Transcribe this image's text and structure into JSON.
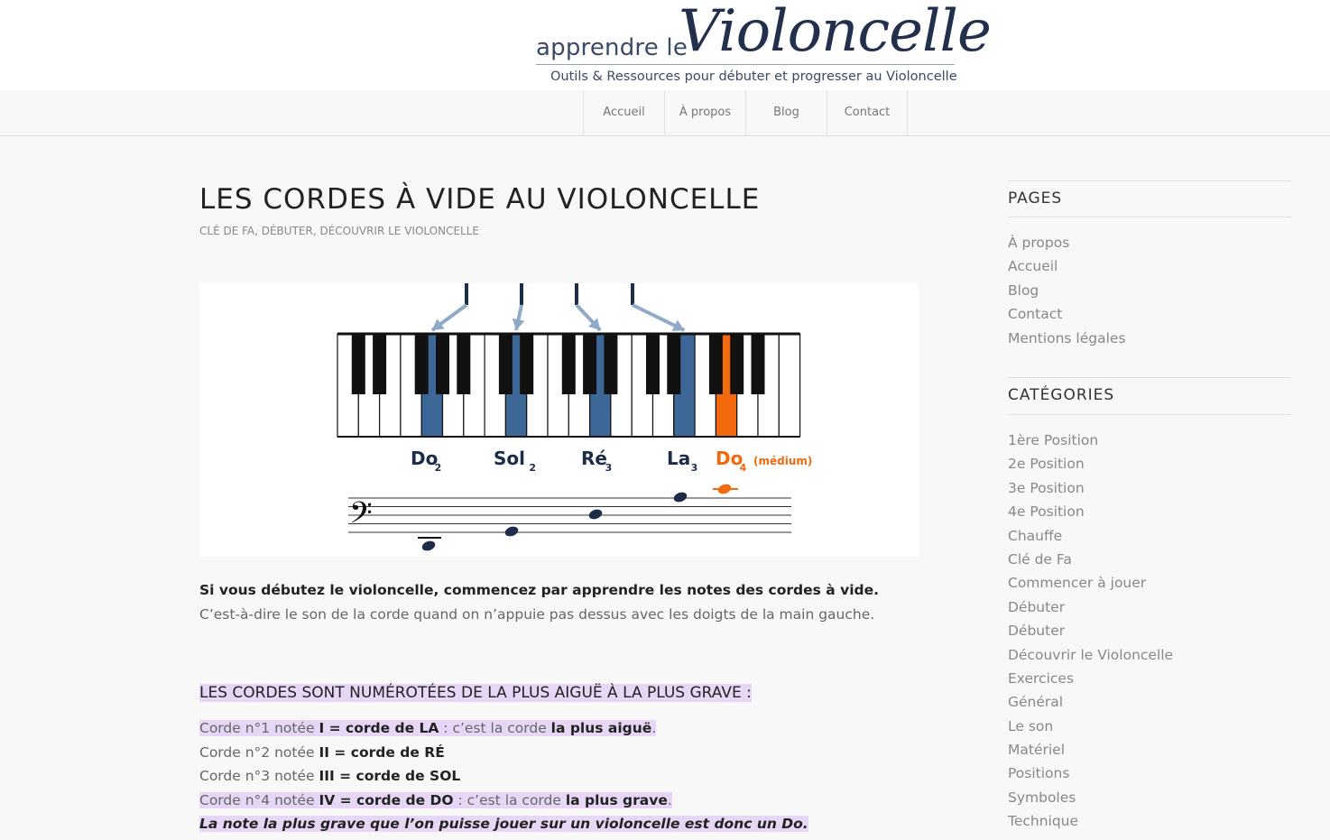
{
  "logo": {
    "small": "apprendre le",
    "big": "Violoncelle",
    "tagline": "Outils & Ressources pour débuter et progresser au Violoncelle"
  },
  "nav": [
    "Accueil",
    "À propos",
    "Blog",
    "Contact"
  ],
  "post": {
    "title": "LES CORDES À VIDE AU VIOLONCELLE",
    "categories": "CLÉ DE FA, DÉBUTER, DÉCOUVRIR LE VIOLONCELLE",
    "figure": {
      "notes": [
        "Do",
        "Sol",
        "Ré",
        "La",
        "Do"
      ],
      "subs": [
        "2",
        "2",
        "3",
        "3",
        "4"
      ],
      "medium": "(médium)",
      "colors": {
        "highlight": "#3d6797",
        "orange": "#f26a0d",
        "arrow": "#8fa9c8",
        "dark": "#1d2c48"
      }
    },
    "intro_bold": "Si vous débutez le violoncelle, commencez par apprendre les notes des cordes à vide.",
    "intro_rest": " C’est-à-dire le son de la corde quand on n’appuie pas dessus avec les doigts de la main gauche.",
    "subhead": "LES CORDES SONT NUMÉROTÉES DE LA PLUS AIGUË À LA PLUS GRAVE :",
    "c1a": "Corde n°1 notée ",
    "c1b": "I = corde de LA",
    "c1c": " : c’est la corde ",
    "c1d": "la plus aiguë",
    "c1e": ".",
    "c2a": "Corde n°2 notée ",
    "c2b": "II = corde de RÉ",
    "c3a": "Corde n°3 notée ",
    "c3b": "III = corde de SOL",
    "c4a": "Corde n°4 notée ",
    "c4b": "IV = corde de DO",
    "c4c": " : c’est la corde ",
    "c4d": "la plus grave",
    "c4e": ".",
    "note": "La note la plus grave que l’on puisse jouer sur un violoncelle est donc un Do."
  },
  "sidebar": {
    "pages_title": "PAGES",
    "pages": [
      "À propos",
      "Accueil",
      "Blog",
      "Contact",
      "Mentions légales"
    ],
    "cats_title": "CATÉGORIES",
    "cats": [
      "1ère Position",
      "2e Position",
      "3e Position",
      "4e Position",
      "Chauffe",
      "Clé de Fa",
      "Commencer à jouer",
      "Débuter",
      "Débuter",
      "Découvrir le Violoncelle",
      "Exercices",
      "Général",
      "Le son",
      "Matériel",
      "Positions",
      "Symboles",
      "Technique"
    ]
  }
}
